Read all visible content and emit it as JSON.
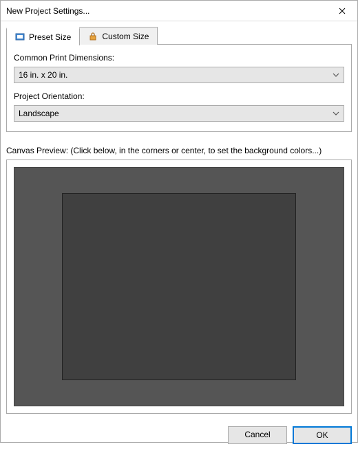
{
  "window": {
    "title": "New Project Settings..."
  },
  "tabs": {
    "preset": {
      "label": "Preset Size"
    },
    "custom": {
      "label": "Custom Size"
    }
  },
  "form": {
    "dimensions_label": "Common Print Dimensions:",
    "dimensions_value": "16 in. x 20 in.",
    "orientation_label": "Project Orientation:",
    "orientation_value": "Landscape"
  },
  "preview": {
    "label": "Canvas Preview: (Click below, in the corners or center, to set the background colors...)"
  },
  "buttons": {
    "cancel": "Cancel",
    "ok": "OK"
  }
}
